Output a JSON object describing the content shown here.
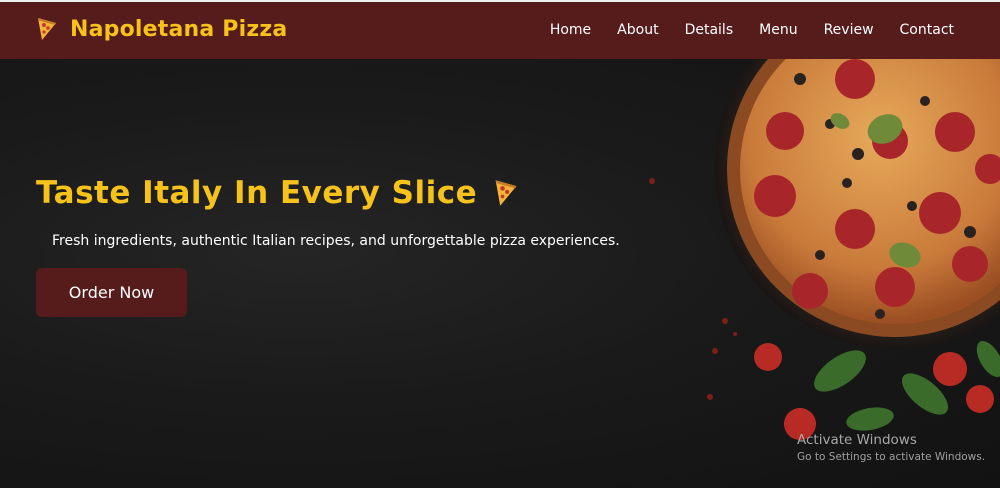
{
  "brand": {
    "name": "Napoletana Pizza",
    "icon": "pizza-slice-icon"
  },
  "nav": {
    "items": [
      {
        "label": "Home"
      },
      {
        "label": "About"
      },
      {
        "label": "Details"
      },
      {
        "label": "Menu"
      },
      {
        "label": "Review"
      },
      {
        "label": "Contact"
      }
    ]
  },
  "hero": {
    "title": "Taste Italy In Every Slice",
    "title_icon": "pizza-slice-icon",
    "subtitle": "Fresh ingredients, authentic Italian recipes, and unforgettable pizza experiences.",
    "cta_label": "Order Now"
  },
  "watermark": {
    "title": "Activate Windows",
    "subtitle": "Go to Settings to activate Windows."
  },
  "colors": {
    "navbar_bg": "#561b1b",
    "accent_yellow": "#f7c21a",
    "hero_bg": "#1a1a1a",
    "button_bg": "#561b1b"
  }
}
